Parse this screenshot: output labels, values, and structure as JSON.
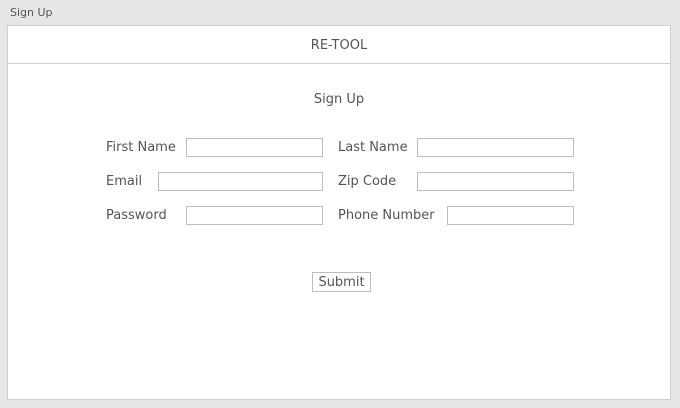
{
  "window": {
    "title": "Sign Up"
  },
  "app": {
    "name": "RE-TOOL"
  },
  "form": {
    "title": "Sign Up",
    "fields": {
      "first_name": {
        "label": "First Name",
        "value": "",
        "placeholder": ""
      },
      "last_name": {
        "label": "Last Name",
        "value": "",
        "placeholder": ""
      },
      "email": {
        "label": "Email",
        "value": "",
        "placeholder": ""
      },
      "zip_code": {
        "label": "Zip Code",
        "value": "",
        "placeholder": ""
      },
      "password": {
        "label": "Password",
        "value": "",
        "placeholder": ""
      },
      "phone_number": {
        "label": "Phone Number",
        "value": "",
        "placeholder": ""
      }
    },
    "submit_label": "Submit"
  }
}
